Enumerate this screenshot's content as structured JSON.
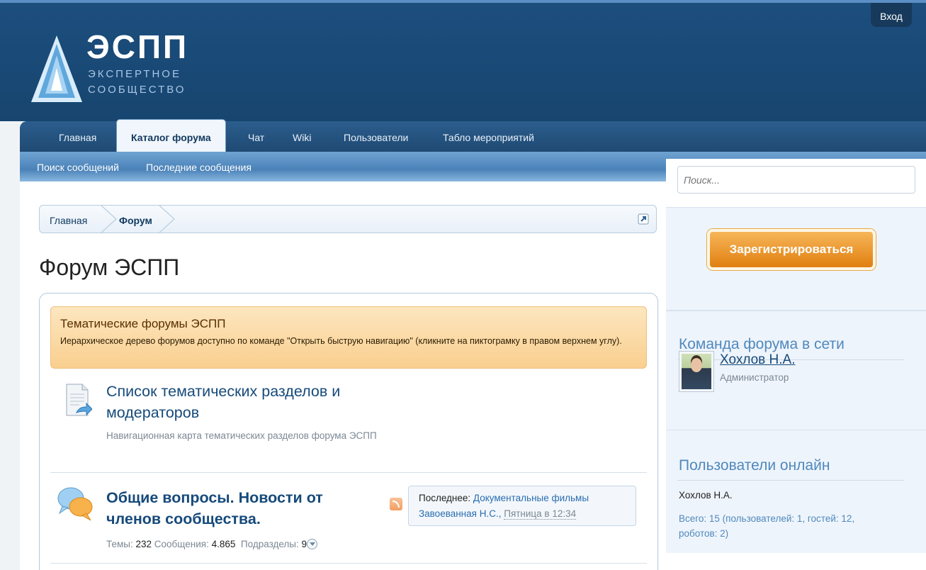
{
  "header": {
    "brand": "ЭСПП",
    "tagline_1": "ЭКСПЕРТНОЕ",
    "tagline_2": "СООБЩЕСТВО",
    "login_label": "Вход"
  },
  "nav": {
    "tabs": [
      {
        "label": "Главная"
      },
      {
        "label": "Каталог форума"
      },
      {
        "label": "Чат"
      },
      {
        "label": "Wiki"
      },
      {
        "label": "Пользователи"
      },
      {
        "label": "Табло мероприятий"
      }
    ],
    "sub_links": [
      {
        "label": "Поиск сообщений"
      },
      {
        "label": "Последние сообщения"
      }
    ]
  },
  "breadcrumb": [
    "Главная",
    "Форум"
  ],
  "page_title": "Форум ЭСПП",
  "category": {
    "title": "Тематические форумы ЭСПП",
    "description": "Иерархическое дерево форумов доступно по команде \"Открыть быструю навигацию\" (кликните на пиктограмку в правом верхнем углу)."
  },
  "nodes": [
    {
      "title": "Список тематических разделов и модераторов",
      "description": "Навигационная карта тематических разделов форума ЭСПП"
    },
    {
      "title": "Общие вопросы. Новости от членов сообщества.",
      "stats": {
        "threads_label": "Темы:",
        "threads": "232",
        "messages_label": "Сообщения:",
        "messages": "4.865",
        "subforums_label": "Подразделы:",
        "subforums": "9"
      },
      "last": {
        "label": "Последнее:",
        "thread": "Документальные фильмы",
        "author": "Завоеванная Н.С.,",
        "time": "Пятница в 12:34"
      }
    }
  ],
  "sidebar": {
    "search_placeholder": "Поиск...",
    "register_label": "Зарегистрироваться",
    "staff": {
      "title": "Команда форума в сети",
      "member_name": "Хохлов Н.А.",
      "member_role": "Администратор"
    },
    "online": {
      "title": "Пользователи онлайн",
      "user": "Хохлов Н.А.",
      "summary": "Всего: 15 (пользователей: 1, гостей: 12, роботов: 2)"
    }
  },
  "colors": {
    "header_bg": "#1c4e7e",
    "accent_link": "#164a7a",
    "category_bg": "#fde6bf",
    "register_button": "#e88d1f"
  }
}
